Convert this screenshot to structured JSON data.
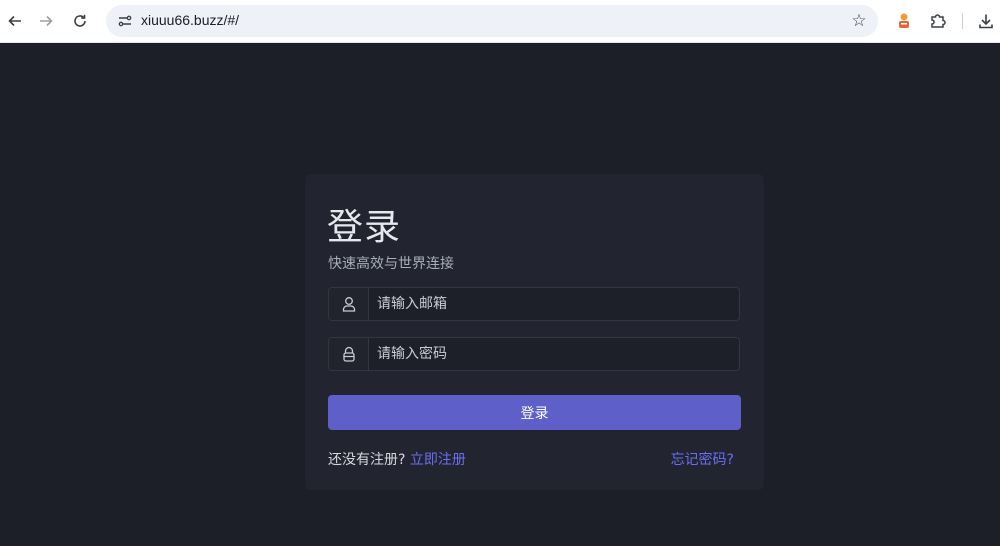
{
  "browser": {
    "url": "xiuuu66.buzz/#/",
    "back_icon": "arrow-left",
    "forward_icon": "arrow-right",
    "reload_icon": "reload",
    "bookmark_icon": "star",
    "extensions_icon": "puzzle",
    "download_icon": "download"
  },
  "login": {
    "title": "登录",
    "subtitle": "快速高效与世界连接",
    "email_placeholder": "请输入邮箱",
    "email_value": "",
    "password_placeholder": "请输入密码",
    "password_value": "",
    "submit_label": "登录",
    "no_account_text": "还没有注册?",
    "register_link": "立即注册",
    "forgot_link": "忘记密码?"
  },
  "colors": {
    "page_background": "#1c1f27",
    "card_background": "#22252f",
    "primary_button": "#5e5fc8",
    "link": "#6b6ef0"
  }
}
